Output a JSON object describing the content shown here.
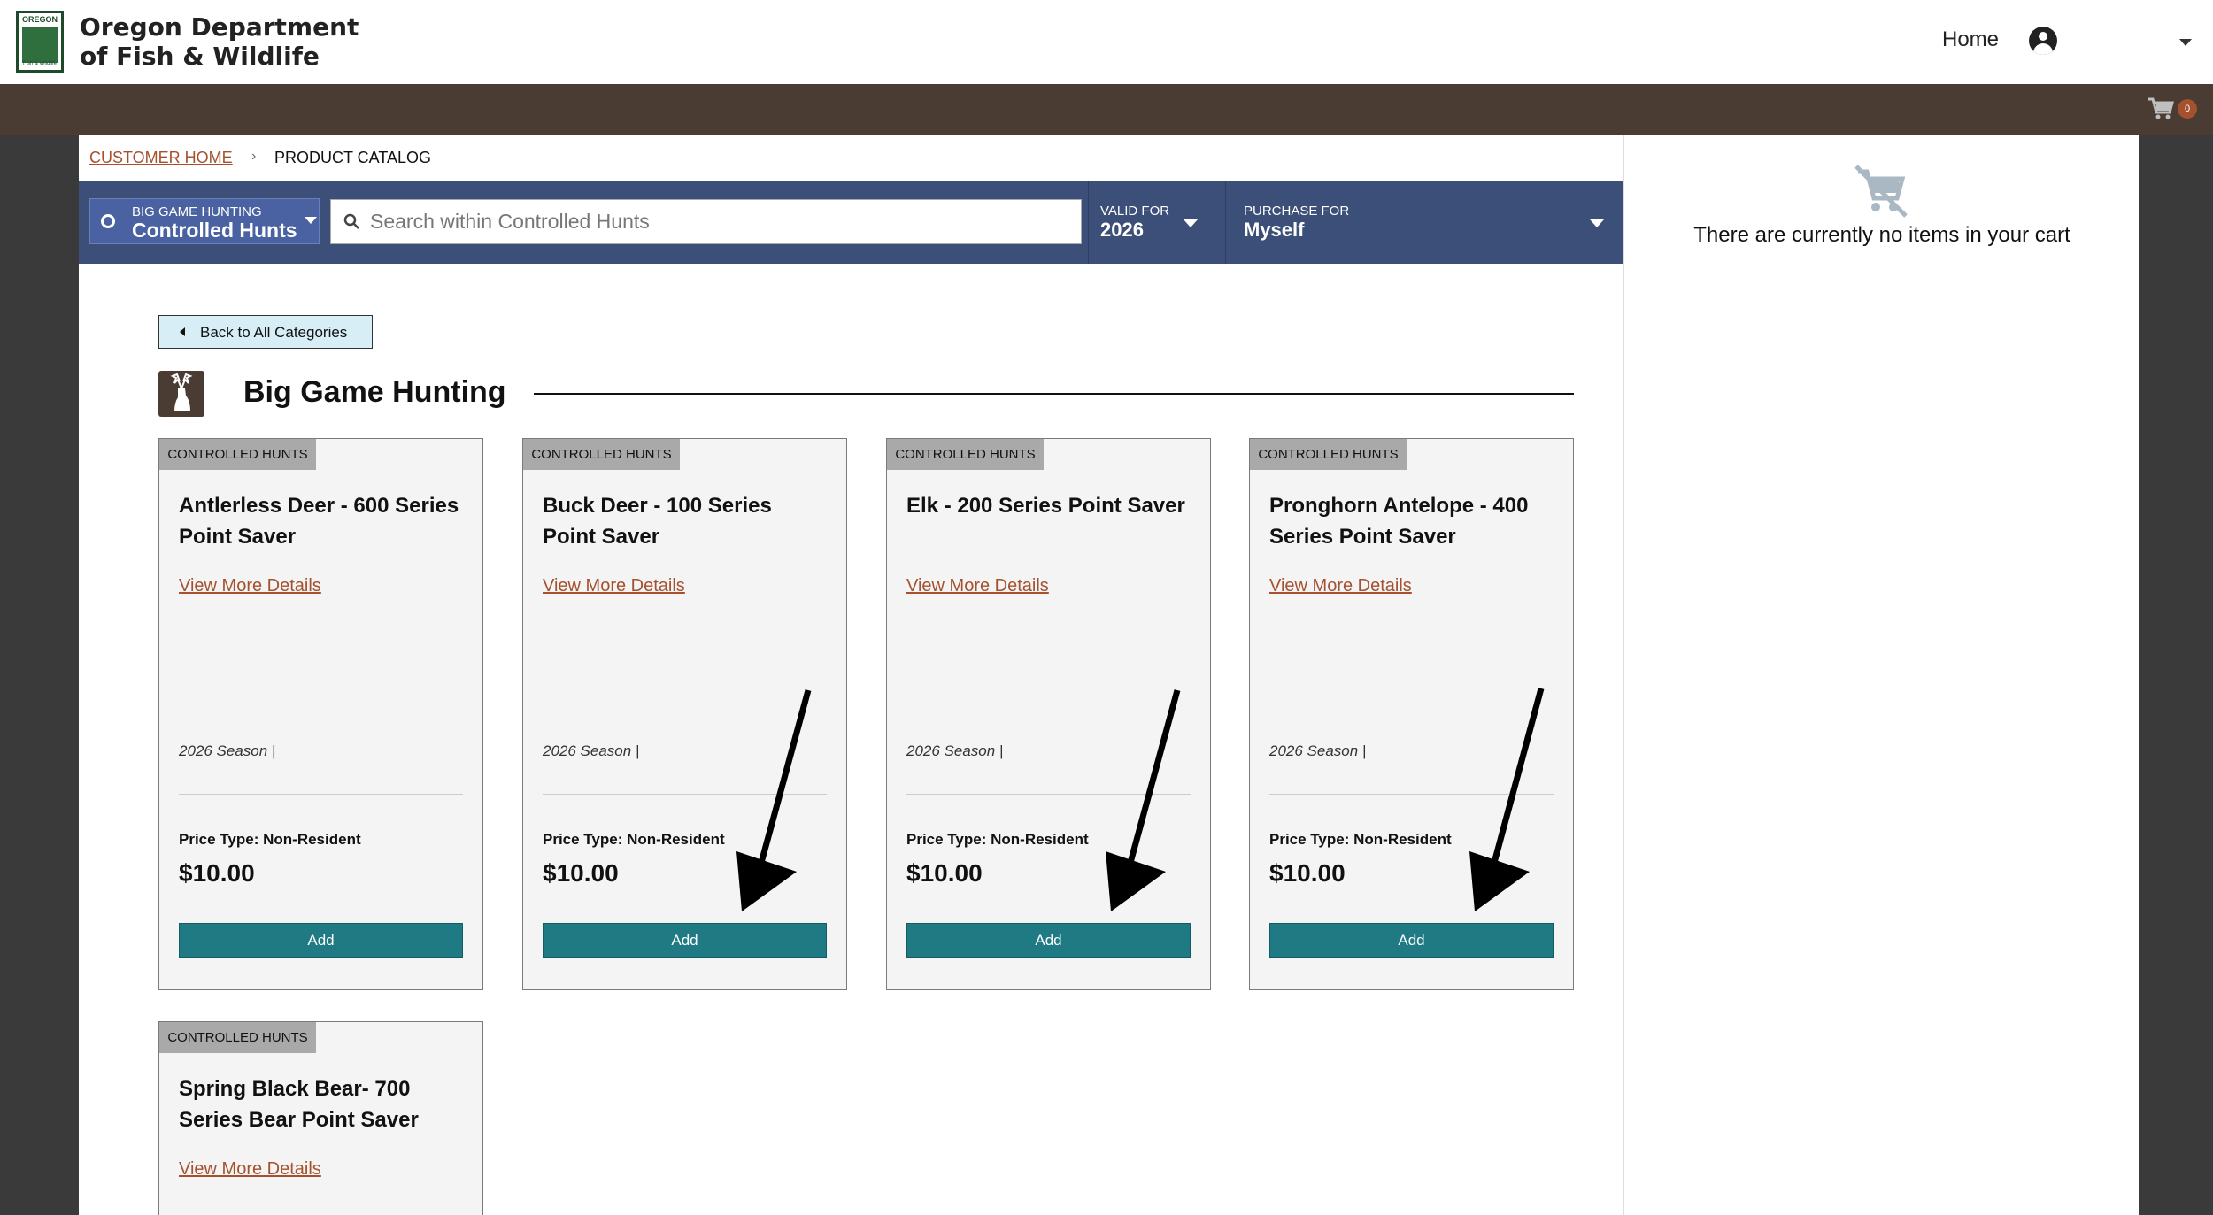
{
  "header": {
    "org_name_line1": "Oregon Department",
    "org_name_line2": "of Fish & Wildlife",
    "logo_top": "OREGON",
    "logo_bottom": "Fish & Wildlife",
    "home_label": "Home"
  },
  "cart": {
    "count": "0",
    "empty_message": "There are currently no items in your cart"
  },
  "breadcrumb": {
    "home": "CUSTOMER HOME",
    "separator": "›",
    "current": "PRODUCT CATALOG"
  },
  "filters": {
    "category_label": "BIG GAME HUNTING",
    "category_value": "Controlled Hunts",
    "search_placeholder": "Search within Controlled Hunts",
    "valid_for_label": "VALID FOR",
    "valid_for_value": "2026",
    "purchase_for_label": "PURCHASE FOR",
    "purchase_for_value": "Myself"
  },
  "back_button": "Back to All Categories",
  "section": {
    "title": "Big Game Hunting"
  },
  "products": [
    {
      "tag": "CONTROLLED HUNTS",
      "title": "Antlerless Deer - 600 Series Point Saver",
      "details_link": "View More Details",
      "season": "2026 Season  |",
      "price_type": "Price Type: Non-Resident",
      "price": "$10.00",
      "add_label": "Add"
    },
    {
      "tag": "CONTROLLED HUNTS",
      "title": "Buck Deer - 100 Series Point Saver",
      "details_link": "View More Details",
      "season": "2026 Season  |",
      "price_type": "Price Type: Non-Resident",
      "price": "$10.00",
      "add_label": "Add"
    },
    {
      "tag": "CONTROLLED HUNTS",
      "title": "Elk - 200 Series Point Saver",
      "details_link": "View More Details",
      "season": "2026 Season  |",
      "price_type": "Price Type: Non-Resident",
      "price": "$10.00",
      "add_label": "Add"
    },
    {
      "tag": "CONTROLLED HUNTS",
      "title": "Pronghorn Antelope - 400 Series Point Saver",
      "details_link": "View More Details",
      "season": "2026 Season  |",
      "price_type": "Price Type: Non-Resident",
      "price": "$10.00",
      "add_label": "Add"
    },
    {
      "tag": "CONTROLLED HUNTS",
      "title": "Spring Black Bear- 700 Series Bear Point Saver",
      "details_link": "View More Details",
      "season": "",
      "price_type": "",
      "price": "",
      "add_label": ""
    }
  ],
  "colors": {
    "brown_band": "#4a3b33",
    "filter_bar": "#3c4f78",
    "add_button": "#1f7a84",
    "link": "#a5512e",
    "cart_badge": "#a5512e"
  },
  "icons": [
    "account-icon",
    "cart-icon",
    "filter-icon",
    "search-icon",
    "chevron-left-icon",
    "deer-icon",
    "empty-cart-icon"
  ]
}
